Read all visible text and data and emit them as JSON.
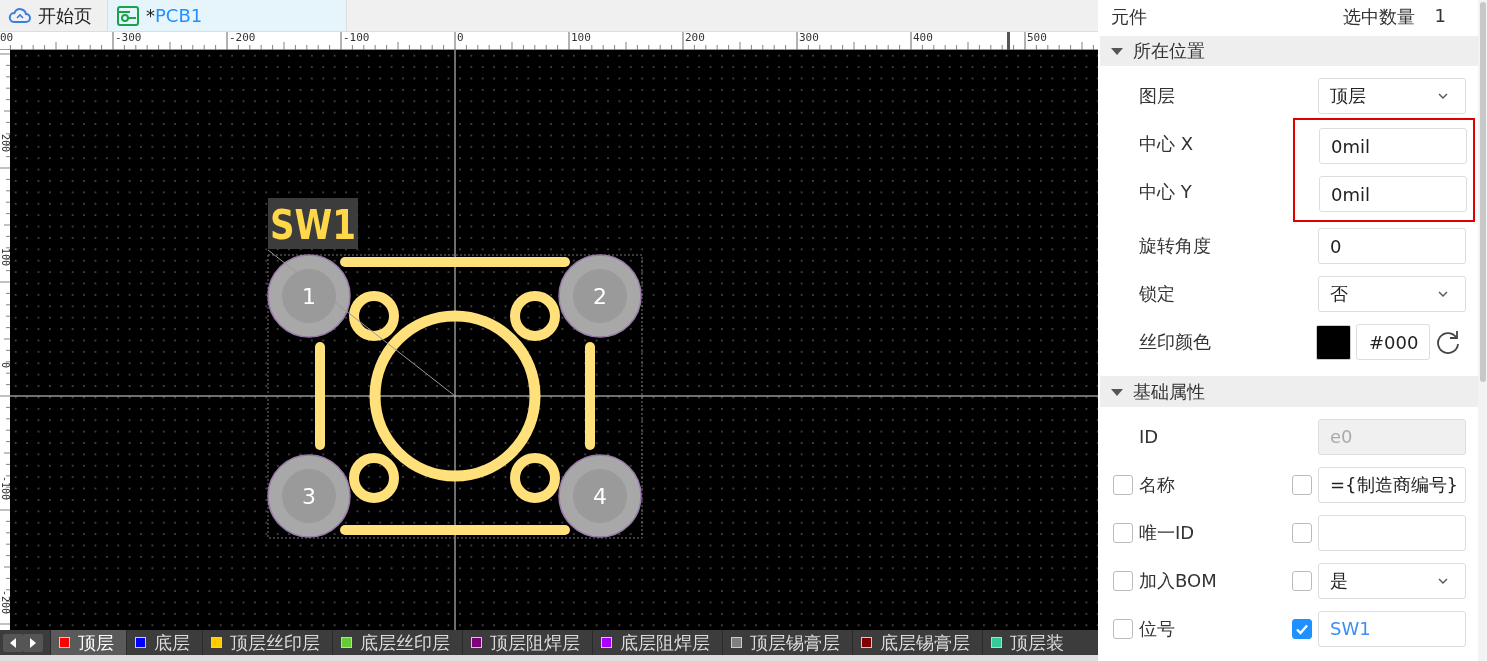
{
  "tabs": [
    {
      "label": "开始页",
      "selected": false
    },
    {
      "modified_mark": "*",
      "label": "PCB1",
      "selected": true
    }
  ],
  "ruler": {
    "horizontal": [
      "00",
      "-300",
      "-200",
      "-100",
      "0",
      "100",
      "200",
      "300",
      "400",
      "500"
    ],
    "vertical": [
      "200",
      "100",
      "0",
      "-100",
      "-200"
    ]
  },
  "canvas": {
    "component": {
      "designator": "SW1",
      "pads": [
        "1",
        "2",
        "3",
        "4"
      ]
    }
  },
  "layers": [
    {
      "label": "顶层",
      "color": "#ff0000",
      "selected": true
    },
    {
      "label": "底层",
      "color": "#0000ff",
      "selected": false
    },
    {
      "label": "顶层丝印层",
      "color": "#ffcc00",
      "selected": false
    },
    {
      "label": "底层丝印层",
      "color": "#66cc33",
      "selected": false
    },
    {
      "label": "顶层阻焊层",
      "color": "#800080",
      "selected": false
    },
    {
      "label": "底层阻焊层",
      "color": "#aa00ff",
      "selected": false
    },
    {
      "label": "顶层锡膏层",
      "color": "#808080",
      "selected": false
    },
    {
      "label": "底层锡膏层",
      "color": "#800000",
      "selected": false
    },
    {
      "label": "顶层装",
      "color": "#33cc99",
      "selected": false
    }
  ],
  "panel": {
    "title": "元件",
    "selection_count_label": "选中数量",
    "selection_count": "1",
    "sections": [
      {
        "title": "所在位置",
        "expanded": true,
        "rows": [
          {
            "kind": "select",
            "label": "图层",
            "value": "顶层"
          },
          {
            "kind": "input",
            "label": "中心 X",
            "value": "0mil",
            "disabled": false,
            "highlighted": true
          },
          {
            "kind": "input",
            "label": "中心 Y",
            "value": "0mil",
            "disabled": false,
            "highlighted": true
          },
          {
            "kind": "input",
            "label": "旋转角度",
            "value": "0",
            "disabled": false
          },
          {
            "kind": "select",
            "label": "锁定",
            "value": "否"
          },
          {
            "kind": "color",
            "label": "丝印颜色",
            "color": "#000000",
            "value": "#000"
          }
        ]
      },
      {
        "title": "基础属性",
        "expanded": true,
        "rows": [
          {
            "kind": "input",
            "label": "ID",
            "value": "e0",
            "disabled": true
          },
          {
            "kind": "check-input",
            "label": "名称",
            "checked": false,
            "value_checked": false,
            "value": "={制造商编号}"
          },
          {
            "kind": "check-input",
            "label": "唯一ID",
            "checked": false,
            "value_checked": false
          },
          {
            "kind": "check-select",
            "label": "加入BOM",
            "checked": false,
            "value_checked": false,
            "value": "是"
          },
          {
            "kind": "check-input",
            "label": "位号",
            "checked": false,
            "value_checked": true,
            "value": "SW1"
          }
        ]
      }
    ]
  }
}
